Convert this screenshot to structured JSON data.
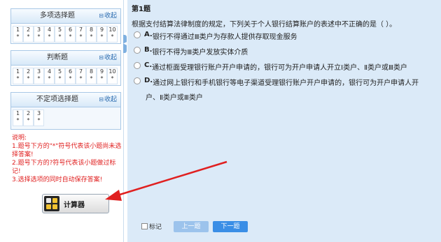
{
  "sidebar": {
    "sections": [
      {
        "title": "多项选择题",
        "collapse_label": "收起",
        "cells": [
          {
            "num": "1",
            "mark": "*"
          },
          {
            "num": "2",
            "mark": "*"
          },
          {
            "num": "3",
            "mark": "*"
          },
          {
            "num": "4",
            "mark": "*"
          },
          {
            "num": "5",
            "mark": "*"
          },
          {
            "num": "6",
            "mark": "*"
          },
          {
            "num": "7",
            "mark": "*"
          },
          {
            "num": "8",
            "mark": "*"
          },
          {
            "num": "9",
            "mark": "*"
          },
          {
            "num": "10",
            "mark": "*"
          }
        ]
      },
      {
        "title": "判断题",
        "collapse_label": "收起",
        "cells": [
          {
            "num": "1",
            "mark": "*"
          },
          {
            "num": "2",
            "mark": "*"
          },
          {
            "num": "3",
            "mark": "*"
          },
          {
            "num": "4",
            "mark": "*"
          },
          {
            "num": "5",
            "mark": "*"
          },
          {
            "num": "6",
            "mark": "*"
          },
          {
            "num": "7",
            "mark": "*"
          },
          {
            "num": "8",
            "mark": "*"
          },
          {
            "num": "9",
            "mark": "*"
          },
          {
            "num": "10",
            "mark": "*"
          }
        ]
      },
      {
        "title": "不定项选择题",
        "collapse_label": "收起",
        "cells": [
          {
            "num": "1",
            "mark": "*"
          },
          {
            "num": "2",
            "mark": "*"
          },
          {
            "num": "3",
            "mark": "*"
          }
        ]
      }
    ],
    "notes": {
      "heading": "说明:",
      "line1": "1.题号下方的\"*\"符号代表该小题尚未选择答案!",
      "line2": "2.题号下方的?符号代表该小题做过标记!",
      "line3": "3.选择选项的同时自动保存答案!"
    },
    "calculator_label": "计算器"
  },
  "question": {
    "title": "第1题",
    "stem": "根据支付结算法律制度的规定，下列关于个人银行结算账户的表述中不正确的是（ ）。",
    "options": [
      {
        "letter": "A.",
        "text": "银行不得通过Ⅲ类户为存款人提供存取现金服务"
      },
      {
        "letter": "B.",
        "text": "银行不得为Ⅲ类户发放实体介质"
      },
      {
        "letter": "C.",
        "text": "通过柜面受理银行账户开户申请的，银行可为开户申请人开立Ⅰ类户、Ⅱ类户或Ⅲ类户"
      },
      {
        "letter": "D.",
        "text": "通过网上银行和手机银行等电子渠道受理银行账户开户申请的，银行可为开户申请人开",
        "continuation": "户、Ⅱ类户或Ⅲ类户"
      }
    ]
  },
  "footer": {
    "mark_label": "标记",
    "prev_label": "上一题",
    "next_label": "下一题"
  },
  "colors": {
    "content_bg": "#dbeaf8",
    "notes_text": "#e02020",
    "annotation_arrow": "#e02020",
    "next_button": "#3a8ee6",
    "prev_button_disabled": "#9cc3ec"
  },
  "icons": {
    "collapse": "collapse-icon",
    "calculator": "calculator-icon",
    "sidebar_toggle": "chevron-left-icon"
  }
}
